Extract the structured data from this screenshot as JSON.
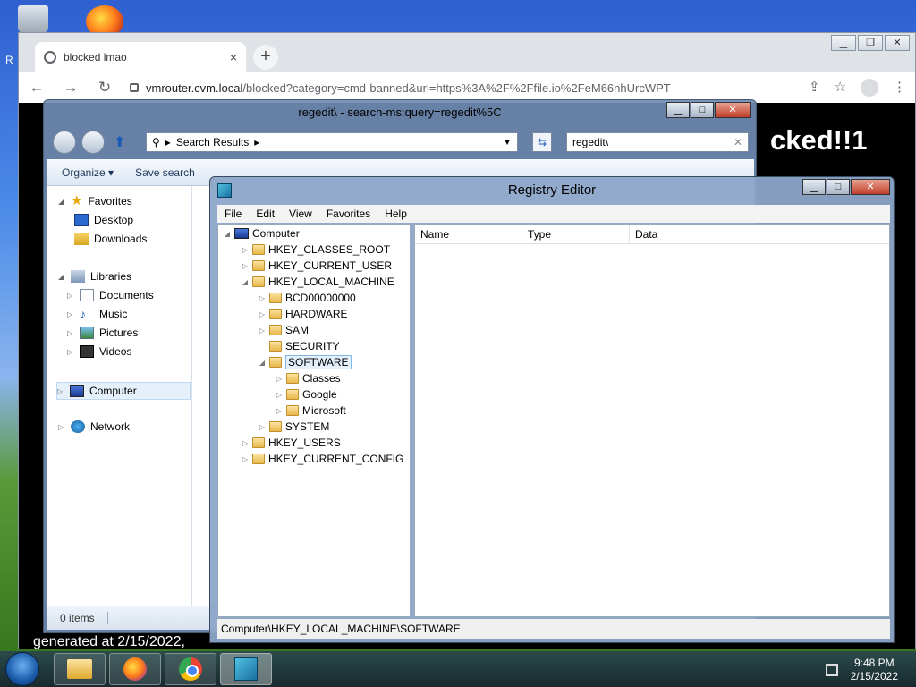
{
  "desktop": {
    "partial_label": "R"
  },
  "browser": {
    "tab_title": "blocked lmao",
    "tab_close": "×",
    "new_tab": "+",
    "url_host": "vmrouter.cvm.local",
    "url_path": "/blocked?category=cmd-banned&url=https%3A%2F%2Ffile.io%2FeM66nhUrcWPT",
    "page_heading_visible": "cked!!1",
    "generated_text": "generated at 2/15/2022,"
  },
  "explorer": {
    "title": "regedit\\ - search-ms:query=regedit%5C",
    "address_label": "Search Results",
    "search_value": "regedit\\",
    "organize_label": "Organize ▾",
    "save_search_label": "Save search",
    "nav": {
      "favorites": "Favorites",
      "desktop": "Desktop",
      "downloads": "Downloads",
      "libraries": "Libraries",
      "documents": "Documents",
      "music": "Music",
      "pictures": "Pictures",
      "videos": "Videos",
      "computer": "Computer",
      "network": "Network"
    },
    "status": "0 items"
  },
  "regedit": {
    "title": "Registry Editor",
    "menu": [
      "File",
      "Edit",
      "View",
      "Favorites",
      "Help"
    ],
    "tree": {
      "computer": "Computer",
      "hkcr": "HKEY_CLASSES_ROOT",
      "hkcu": "HKEY_CURRENT_USER",
      "hklm": "HKEY_LOCAL_MACHINE",
      "bcd": "BCD00000000",
      "hardware": "HARDWARE",
      "sam": "SAM",
      "security": "SECURITY",
      "software": "SOFTWARE",
      "classes": "Classes",
      "google": "Google",
      "microsoft": "Microsoft",
      "system": "SYSTEM",
      "hku": "HKEY_USERS",
      "hkcc": "HKEY_CURRENT_CONFIG"
    },
    "columns": [
      "Name",
      "Type",
      "Data"
    ],
    "status_path": "Computer\\HKEY_LOCAL_MACHINE\\SOFTWARE"
  },
  "taskbar": {
    "time": "9:48 PM",
    "date": "2/15/2022"
  },
  "colors": {
    "selection": "#e5f0fb",
    "page_background": "#000000"
  }
}
